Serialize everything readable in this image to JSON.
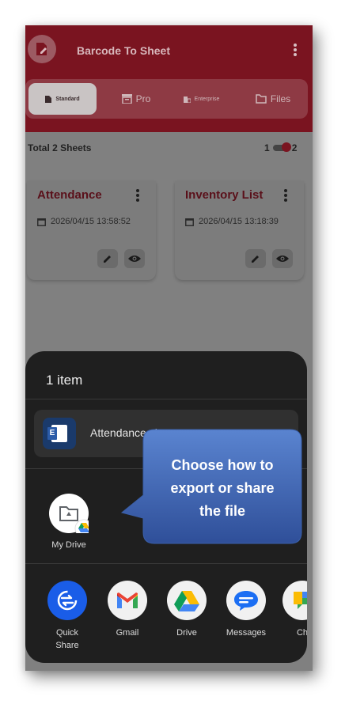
{
  "app": {
    "title": "Barcode To Sheet"
  },
  "tabs": [
    {
      "label": "Standard",
      "icon": "document-icon",
      "active": true
    },
    {
      "label": "Pro",
      "icon": "archive-icon",
      "active": false
    },
    {
      "label": "Enterprise",
      "icon": "building-icon",
      "active": false
    },
    {
      "label": "Files",
      "icon": "folder-icon",
      "active": false
    }
  ],
  "summary": {
    "total_label": "Total 2 Sheets",
    "toggle_left": "1",
    "toggle_right": "2"
  },
  "sheets": [
    {
      "title": "Attendance",
      "date": "2026/04/15 13:58:52"
    },
    {
      "title": "Inventory List",
      "date": "2026/04/15 13:18:39"
    }
  ],
  "share_sheet": {
    "title": "1 item",
    "file_name": "Attendance.xl",
    "suggested": {
      "label": "My Drive",
      "icon": "drive-folder-icon"
    },
    "apps": [
      {
        "label": "Quick\nShare",
        "icon": "quick-share-icon"
      },
      {
        "label": "Gmail",
        "icon": "gmail-icon"
      },
      {
        "label": "Drive",
        "icon": "google-drive-icon"
      },
      {
        "label": "Messages",
        "icon": "messages-icon"
      },
      {
        "label": "Ch",
        "icon": "chat-icon"
      }
    ]
  },
  "callout": {
    "line1": "Choose how to",
    "line2": "export or share",
    "line3": "the file"
  },
  "colors": {
    "header": "#7a1420",
    "sheet_bg": "#1f1f1f",
    "callout_fill": "#3f63b0"
  }
}
